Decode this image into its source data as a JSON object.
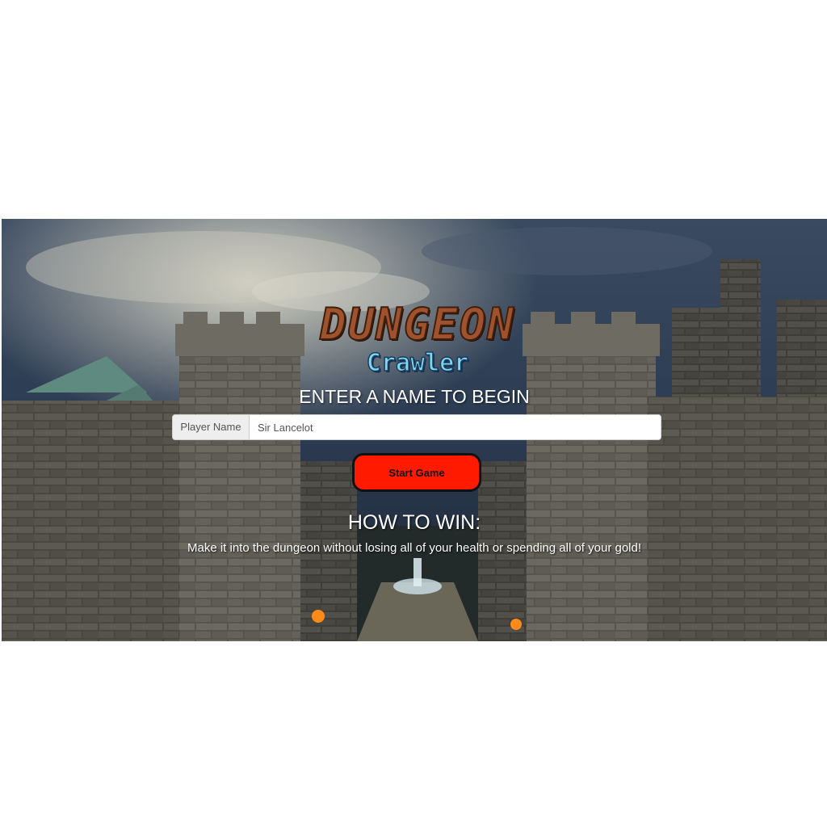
{
  "logo": {
    "title": "DUNGEON",
    "subtitle": "Crawler"
  },
  "form": {
    "heading": "ENTER A NAME TO BEGIN",
    "input_label": "Player Name",
    "input_value": "Sir Lancelot",
    "start_button": "Start Game"
  },
  "instructions": {
    "heading": "HOW TO WIN:",
    "text": "Make it into the dungeon without losing all of your health or spending all of your gold!"
  },
  "colors": {
    "button_bg": "#ff1a00",
    "logo_brown": "#a0522d",
    "logo_cyan": "#7fd6f0"
  }
}
